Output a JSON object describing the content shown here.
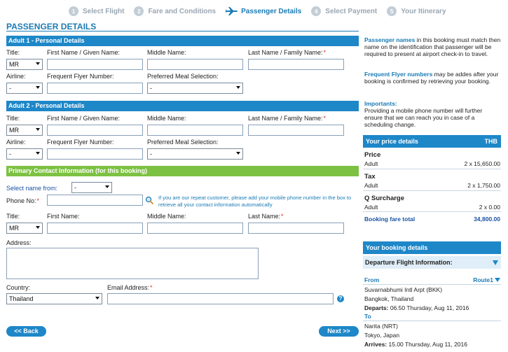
{
  "steps": [
    {
      "num": "1",
      "label": "Select Flight"
    },
    {
      "num": "2",
      "label": "Fare and Conditions"
    },
    {
      "num": "",
      "label": "Passenger Details"
    },
    {
      "num": "4",
      "label": "Select Payment"
    },
    {
      "num": "5",
      "label": "Your Itinerary"
    }
  ],
  "page_title": "PASSENGER DETAILS",
  "labels": {
    "title": "Title:",
    "first_name": "First Name / Given Name:",
    "middle_name": "Middle Name:",
    "last_name": "Last Name / Family Name:",
    "airline": "Airline:",
    "ff_number": "Frequent Flyer Number:",
    "meal": "Preferred Meal Selection:",
    "contact_first": "First Name:",
    "contact_middle": "Middle Name:",
    "contact_last": "Last Name:",
    "select_name": "Select name from:",
    "phone": "Phone No:",
    "address": "Address:",
    "country": "Country:",
    "email": "Email Address:"
  },
  "adult1": {
    "heading": "Adult 1 - Personal Details",
    "title_value": "MR",
    "airline_value": "-",
    "meal_value": "-"
  },
  "adult2": {
    "heading": "Adult 2 - Personal Details",
    "title_value": "MR",
    "airline_value": "-",
    "meal_value": "-"
  },
  "contact": {
    "heading": "Primary Contact Information (for this booking)",
    "select_name_value": "-",
    "title_value": "MR",
    "country_value": "Thailand",
    "hint": "If you are our repeat customer, please add your mobile phone number in the box to retrieve all your contact information automatically"
  },
  "buttons": {
    "back": "<< Back",
    "next": "Next >>"
  },
  "side": {
    "passenger_names_hl": "Passenger names",
    "passenger_names_text": " in this booking must match then name on the identification that passenger will be required to present at airport check-in to travel.",
    "ff_hl": "Frequent Flyer numbers",
    "ff_text": " may be addes after your booking is confirmed by retrieving your booking.",
    "important_hl": "Importants:",
    "important_text": "Providing a mobile phone number will further ensure that we can reach you in case of a scheduling change."
  },
  "price": {
    "heading": "Your price details",
    "currency": "THB",
    "sections": [
      {
        "label": "Price",
        "row_label": "Adult",
        "row_value": "2 x 15,650.00"
      },
      {
        "label": "Tax",
        "row_label": "Adult",
        "row_value": "2 x 1,750.00"
      },
      {
        "label": "Q Surcharge",
        "row_label": "Adult",
        "row_value": "2 x 0.00"
      }
    ],
    "total_label": "Booking fare total",
    "total_value": "34,800.00"
  },
  "booking": {
    "heading": "Your booking details",
    "departure_heading": "Departure Flight Information:",
    "from_label": "From",
    "route_label": "Route1",
    "from_airport": "Suvarnabhumi Intl Arpt (BKK)",
    "from_city": "Bangkok, Thailand",
    "departs_label": "Departs:",
    "departs_value": "06.50 Thursday, Aug 11, 2016",
    "to_label": "To",
    "to_airport": "Narita (NRT)",
    "to_city": "Tokyo, Japan",
    "arrives_label": "Arrives:",
    "arrives_value": "15.00 Thursday, Aug 11, 2016"
  },
  "colors": {
    "accent": "#1e87c8",
    "contact_bar": "#7dc142",
    "required": "#e0312d"
  }
}
